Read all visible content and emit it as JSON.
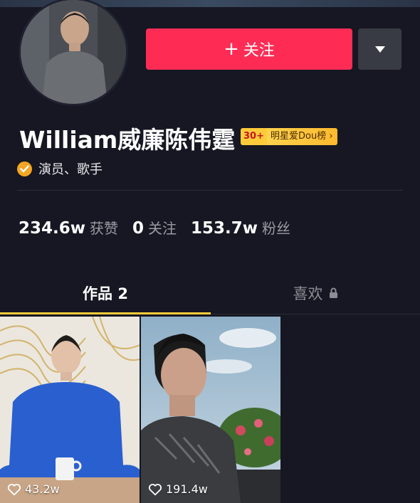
{
  "profile": {
    "name": "William威廉陈伟霆",
    "role": "演员、歌手",
    "rank_badge": {
      "number": "30+",
      "text": "明星爱Dou榜 ›"
    }
  },
  "actions": {
    "follow_label": "关注",
    "follow_plus": "+"
  },
  "stats": [
    {
      "value": "234.6w",
      "label": "获赞"
    },
    {
      "value": "0",
      "label": "关注"
    },
    {
      "value": "153.7w",
      "label": "粉丝"
    }
  ],
  "tabs": {
    "works": "作品 2",
    "likes": "喜欢"
  },
  "videos": [
    {
      "likes": "43.2w"
    },
    {
      "likes": "191.4w"
    }
  ],
  "colors": {
    "background": "#161722",
    "follow": "#fe2c55",
    "tab_underline": "#fdcd3a",
    "verify": "#f5a623"
  },
  "icons": {
    "dropdown": "triangle-down-icon",
    "verify": "check-circle-icon",
    "lock": "lock-icon",
    "heart": "heart-outline-icon"
  }
}
